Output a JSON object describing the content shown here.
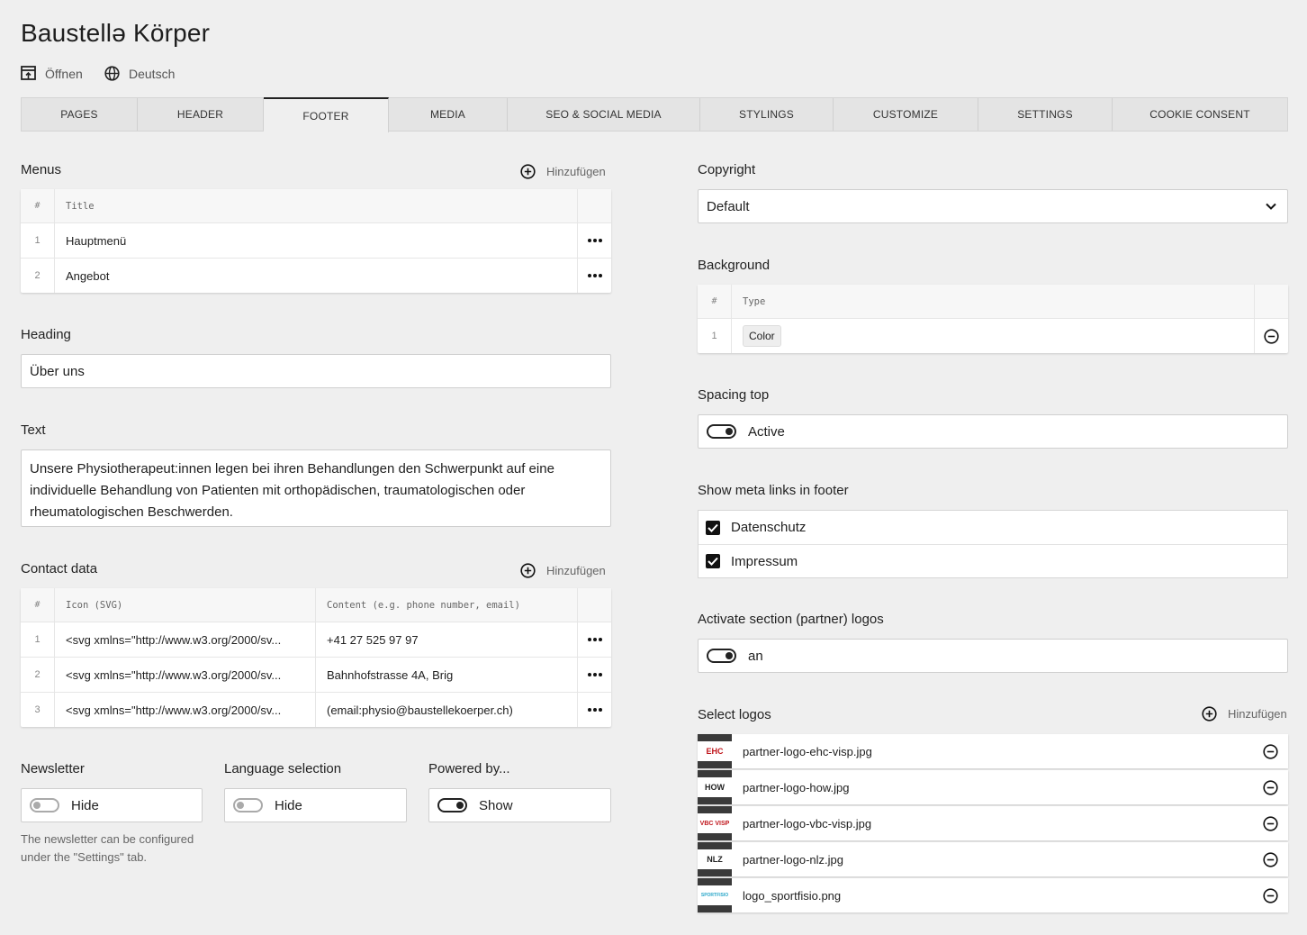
{
  "page": {
    "title": "Baustellə Körper",
    "open_label": "Öffnen",
    "language_label": "Deutsch"
  },
  "tabs": [
    "PAGES",
    "HEADER",
    "FOOTER",
    "MEDIA",
    "SEO & SOCIAL MEDIA",
    "STYLINGS",
    "CUSTOMIZE",
    "SETTINGS",
    "COOKIE CONSENT"
  ],
  "active_tab": "FOOTER",
  "menus": {
    "label": "Menus",
    "add_label": "Hinzufügen",
    "col_num": "#",
    "col_title": "Title",
    "rows": [
      {
        "num": "1",
        "title": "Hauptmenü"
      },
      {
        "num": "2",
        "title": "Angebot"
      }
    ]
  },
  "heading": {
    "label": "Heading",
    "value": "Über uns"
  },
  "text": {
    "label": "Text",
    "value": "Unsere Physiotherapeut:innen legen bei ihren Behandlungen den Schwerpunkt auf eine individuelle Behandlung von Patienten mit orthopädischen, traumatologischen oder rheumatologischen Beschwerden."
  },
  "contact": {
    "label": "Contact data",
    "add_label": "Hinzufügen",
    "col_num": "#",
    "col_icon": "Icon (SVG)",
    "col_content": "Content (e.g. phone number, email)",
    "rows": [
      {
        "num": "1",
        "icon": "<svg xmlns=\"http://www.w3.org/2000/sv...",
        "content": "+41 27 525 97 97"
      },
      {
        "num": "2",
        "icon": "<svg xmlns=\"http://www.w3.org/2000/sv...",
        "content": "Bahnhofstrasse 4A, Brig"
      },
      {
        "num": "3",
        "icon": "<svg xmlns=\"http://www.w3.org/2000/sv...",
        "content": "(email:physio@baustellekoerper.ch)"
      }
    ]
  },
  "newsletter": {
    "label": "Newsletter",
    "value": "Hide",
    "hint": "The newsletter can be configured under the \"Settings\" tab."
  },
  "language_selection": {
    "label": "Language selection",
    "value": "Hide"
  },
  "powered_by": {
    "label": "Powered by...",
    "value": "Show"
  },
  "copyright": {
    "label": "Copyright",
    "value": "Default"
  },
  "background": {
    "label": "Background",
    "col_num": "#",
    "col_type": "Type",
    "rows": [
      {
        "num": "1",
        "type": "Color"
      }
    ]
  },
  "spacing_top": {
    "label": "Spacing top",
    "value": "Active"
  },
  "meta_links": {
    "label": "Show meta links in footer",
    "items": [
      {
        "label": "Datenschutz",
        "checked": true
      },
      {
        "label": "Impressum",
        "checked": true
      }
    ]
  },
  "partner_logos_section": {
    "label": "Activate section (partner) logos",
    "value": "an"
  },
  "logos": {
    "label": "Select logos",
    "add_label": "Hinzufügen",
    "items": [
      {
        "file": "partner-logo-ehc-visp.jpg",
        "thumb_text": "EHC",
        "thumb_color": "#c0161c"
      },
      {
        "file": "partner-logo-how.jpg",
        "thumb_text": "HOW",
        "thumb_color": "#222222"
      },
      {
        "file": "partner-logo-vbc-visp.jpg",
        "thumb_text": "VBC VISP",
        "thumb_color": "#c0161c"
      },
      {
        "file": "partner-logo-nlz.jpg",
        "thumb_text": "NLZ",
        "thumb_color": "#222222"
      },
      {
        "file": "logo_sportfisio.png",
        "thumb_text": "SPORTFISIO",
        "thumb_color": "#2aa7c9"
      }
    ]
  }
}
